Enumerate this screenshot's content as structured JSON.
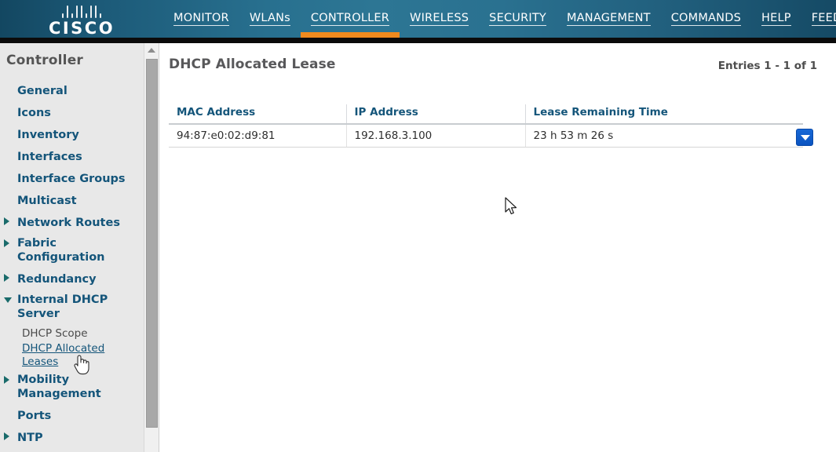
{
  "brand": {
    "name": "CISCO",
    "logo_icon": "cisco-bars-logo"
  },
  "nav": {
    "items": [
      {
        "label": "MONITOR",
        "accel": "M",
        "active": false
      },
      {
        "label": "WLANs",
        "accel": "W",
        "active": false
      },
      {
        "label": "CONTROLLER",
        "accel": "C",
        "active": true
      },
      {
        "label": "WIRELESS",
        "accel": "I",
        "active": false
      },
      {
        "label": "SECURITY",
        "accel": "S",
        "active": false
      },
      {
        "label": "MANAGEMENT",
        "accel": "A",
        "active": false
      },
      {
        "label": "COMMANDS",
        "accel": "O",
        "active": false
      },
      {
        "label": "HELP",
        "accel": "L",
        "active": false
      },
      {
        "label": "FEEDBACK",
        "accel": "F",
        "active": false
      }
    ],
    "active_accent_color": "#f08a1e"
  },
  "sidebar": {
    "title": "Controller",
    "items": [
      {
        "label": "General",
        "caret": "none",
        "type": "link"
      },
      {
        "label": "Icons",
        "caret": "none",
        "type": "link"
      },
      {
        "label": "Inventory",
        "caret": "none",
        "type": "link"
      },
      {
        "label": "Interfaces",
        "caret": "none",
        "type": "link"
      },
      {
        "label": "Interface Groups",
        "caret": "none",
        "type": "link"
      },
      {
        "label": "Multicast",
        "caret": "none",
        "type": "link"
      },
      {
        "label": "Network Routes",
        "caret": "closed",
        "type": "link"
      },
      {
        "label": "Fabric Configuration",
        "caret": "closed",
        "type": "link"
      },
      {
        "label": "Redundancy",
        "caret": "closed",
        "type": "link"
      },
      {
        "label": "Internal DHCP Server",
        "caret": "open",
        "type": "link"
      },
      {
        "label": "DHCP Scope",
        "caret": "none",
        "type": "sub-plain"
      },
      {
        "label": "DHCP Allocated Leases",
        "caret": "none",
        "type": "sub-link",
        "selected": true
      },
      {
        "label": "Mobility Management",
        "caret": "closed",
        "type": "link"
      },
      {
        "label": "Ports",
        "caret": "none",
        "type": "link"
      },
      {
        "label": "NTP",
        "caret": "closed",
        "type": "link"
      }
    ],
    "scrollbar": {
      "up_arrow_icon": "scroll-up-arrow-icon"
    }
  },
  "main": {
    "page_title": "DHCP Allocated Lease",
    "entries_label": "Entries 1 - 1 of 1",
    "table": {
      "columns": [
        "MAC Address",
        "IP Address",
        "Lease Remaining Time"
      ],
      "rows": [
        {
          "mac": "94:87:e0:02:d9:81",
          "ip": "192.168.3.100",
          "lease": "23 h 53 m 26 s"
        }
      ],
      "row_action_icon": "chevron-down-icon",
      "row_action_color": "#0a53c0"
    }
  },
  "cursors": {
    "pointer_icon": "arrow-cursor-icon",
    "hand_icon": "hand-pointer-cursor-icon"
  }
}
